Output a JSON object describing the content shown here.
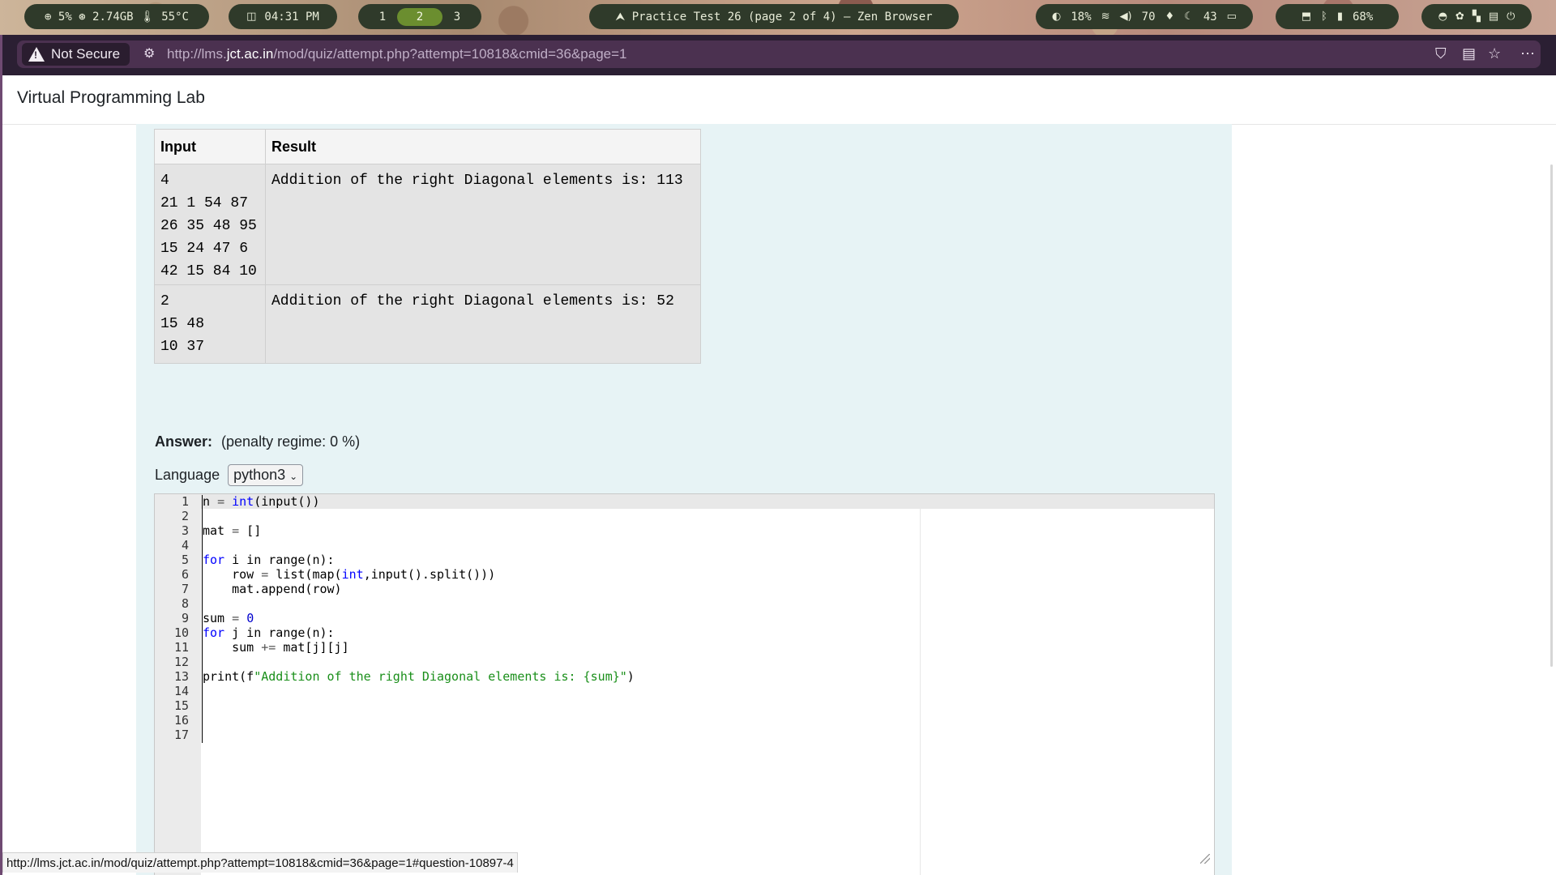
{
  "topbar": {
    "sysinfo": "⊕ 5%  ⊛ 2.74GB  🌡 55°C",
    "clock": "04:31 PM",
    "workspaces": [
      "1",
      "2",
      "3"
    ],
    "active_workspace": "2",
    "window_title": "⮝ Practice Test 26 (page 2 of 4) — Zen Browser",
    "brightness": "18%",
    "volume": "70",
    "moon_value": "43",
    "battery": "68%"
  },
  "browser": {
    "security_label": "Not Secure",
    "url_prefix": "http://lms.",
    "url_domain": "jct.ac.in",
    "url_suffix": "/mod/quiz/attempt.php?attempt=10818&cmid=36&page=1"
  },
  "page": {
    "title": "Virtual Programming Lab",
    "table_headers": [
      "Input",
      "Result"
    ],
    "table_rows": [
      {
        "input": "4\n21 1 54 87\n26 35 48 95\n15 24 47 6\n42 15 84 10",
        "result": "Addition of the right Diagonal elements is: 113"
      },
      {
        "input": "2\n15 48\n10 37",
        "result": "Addition of the right Diagonal elements is: 52"
      }
    ],
    "answer_label": "Answer:",
    "penalty": "(penalty regime: 0 %)",
    "language_label": "Language",
    "language_value": "python3",
    "line_count": 17
  },
  "status_url": "http://lms.jct.ac.in/mod/quiz/attempt.php?attempt=10818&cmid=36&page=1#question-10897-4",
  "colors": {
    "browser_chrome": "#2b1f33",
    "urlbar": "#4b3150",
    "content_bg": "#e7f3f5",
    "topbar_pill": "#2f3a2a",
    "workspace_active": "#6b8e2f"
  }
}
